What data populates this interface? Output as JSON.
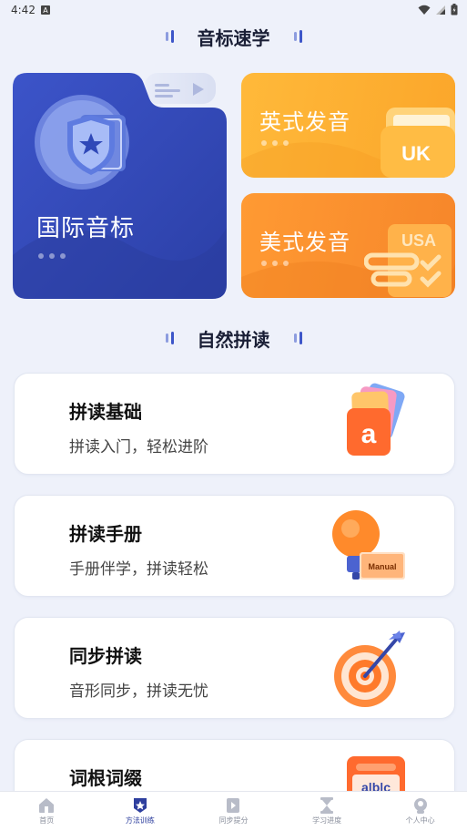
{
  "status_bar": {
    "time": "4:42",
    "badge": "A"
  },
  "sections": {
    "phonetics_title": "音标速学",
    "phonics_title": "自然拼读"
  },
  "phonetic_cards": {
    "international": {
      "label": "国际音标"
    },
    "british": {
      "label": "英式发音",
      "tag": "UK"
    },
    "american": {
      "label": "美式发音",
      "tag": "USA"
    }
  },
  "phonics_items": [
    {
      "title": "拼读基础",
      "desc": "拼读入门，轻松进阶",
      "icon": "letter-a-cards-icon",
      "art_text": "a"
    },
    {
      "title": "拼读手册",
      "desc": "手册伴学，拼读轻松",
      "icon": "manual-lightbulb-icon",
      "art_text": "Manual"
    },
    {
      "title": "同步拼读",
      "desc": "音形同步，拼读无忧",
      "icon": "target-arrow-icon"
    },
    {
      "title": "词根词缀",
      "desc": "",
      "icon": "abc-board-icon",
      "art_text": "a|b|c"
    }
  ],
  "bottom_nav": [
    {
      "label": "首页",
      "icon": "home-icon",
      "active": false
    },
    {
      "label": "方法训练",
      "icon": "training-icon",
      "active": true
    },
    {
      "label": "同步提分",
      "icon": "book-play-icon",
      "active": false
    },
    {
      "label": "学习进度",
      "icon": "hourglass-icon",
      "active": false
    },
    {
      "label": "个人中心",
      "icon": "profile-icon",
      "active": false
    }
  ],
  "colors": {
    "background": "#EEF1FA",
    "accent_blue": "#3D56C9",
    "card_blue": "#3349B8",
    "card_orange_uk": "#FBAA2E",
    "card_orange_us": "#F78D2C",
    "nav_active": "#2E3F9E"
  }
}
